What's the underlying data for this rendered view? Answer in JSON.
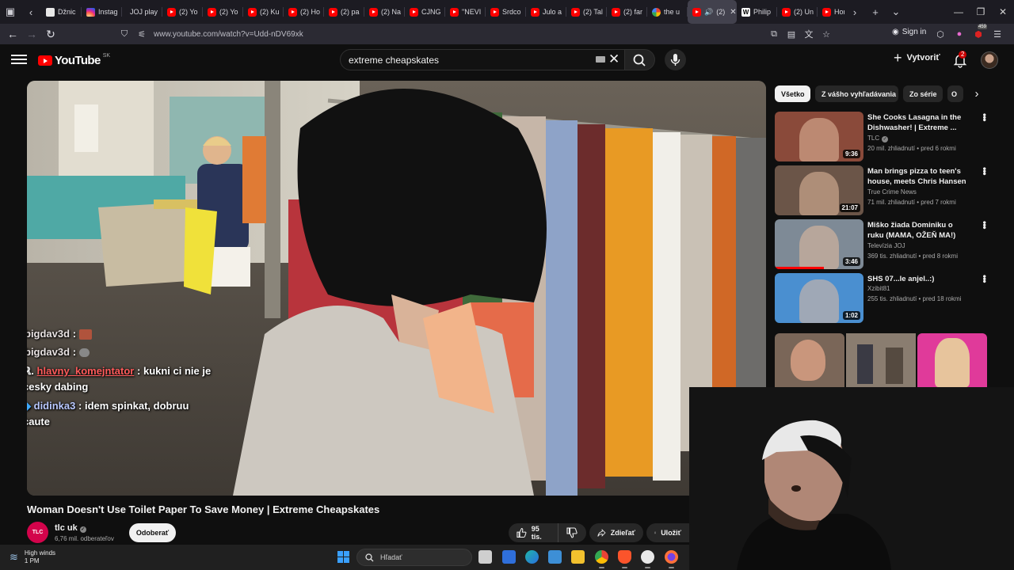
{
  "browser": {
    "tabs": [
      {
        "label": "Džnic",
        "icon": "doc"
      },
      {
        "label": "Instag",
        "icon": "instagram"
      },
      {
        "label": "JOJ play",
        "icon": "none"
      },
      {
        "label": "(2) Yo",
        "icon": "youtube"
      },
      {
        "label": "(2) Yo",
        "icon": "youtube"
      },
      {
        "label": "(2) Ku",
        "icon": "youtube"
      },
      {
        "label": "(2) Ho",
        "icon": "youtube"
      },
      {
        "label": "(2) pa",
        "icon": "youtube"
      },
      {
        "label": "(2) Na",
        "icon": "youtube"
      },
      {
        "label": "CJNG",
        "icon": "youtube"
      },
      {
        "label": "\"NEVI",
        "icon": "youtube"
      },
      {
        "label": "Srdco",
        "icon": "youtube"
      },
      {
        "label": "Julo a",
        "icon": "youtube"
      },
      {
        "label": "(2) Tal",
        "icon": "youtube"
      },
      {
        "label": "(2) far",
        "icon": "youtube"
      },
      {
        "label": "the u",
        "icon": "google"
      },
      {
        "label": "(2)",
        "icon": "youtube",
        "active": true
      },
      {
        "label": "Philip",
        "icon": "wikipedia"
      },
      {
        "label": "(2) Un",
        "icon": "youtube"
      },
      {
        "label": "Horvá",
        "icon": "youtube"
      }
    ],
    "url": "www.youtube.com/watch?v=Udd-nDV69xk",
    "sign_in": "Sign in",
    "extension_badge": "459"
  },
  "youtube": {
    "logo_text": "YouTube",
    "country_code": "SK",
    "search_query": "extreme cheapskates",
    "create_label": "Vytvoriť",
    "notification_count": "2"
  },
  "video": {
    "title": "Woman Doesn't Use Toilet Paper To Save Money | Extreme Cheapskates",
    "channel": "tlc uk",
    "channel_avatar_text": "TLC",
    "subscribers": "6,76 mil. odberateľov",
    "subscribe_label": "Odoberať",
    "likes": "95 tis.",
    "share_label": "Zdieľať",
    "save_label": "Uložiť"
  },
  "chat": [
    {
      "user": "bigdav3d",
      "sep": ":",
      "message": ""
    },
    {
      "user": "bigdav3d",
      "sep": ":",
      "message": ""
    },
    {
      "user": "hlavny_komejntator",
      "sep": ":",
      "message": "kukni ci nie je",
      "cont": "cesky dabing"
    },
    {
      "user": "didinka3",
      "sep": ":",
      "message": "idem spinkat, dobruu",
      "cont": "caute"
    }
  ],
  "chips": [
    "Všetko",
    "Z vášho vyhľadávania",
    "Zo série",
    "O"
  ],
  "recommendations": [
    {
      "title": "She Cooks Lasagna in the Dishwasher! | Extreme ...",
      "channel": "TLC",
      "verified": true,
      "meta": "20 mil. zhliadnutí • pred 6 rokmi",
      "duration": "9:36",
      "thumb_color": "#8a4a3a"
    },
    {
      "title": "Man brings pizza to teen's house, meets Chris Hansen ...",
      "channel": "True Crime News",
      "verified": false,
      "meta": "71 mil. zhliadnutí • pred 7 rokmi",
      "duration": "21:07",
      "thumb_color": "#6b5548"
    },
    {
      "title": "Miško žiada Dominiku o ruku (MAMA, OŽEŇ MA!)",
      "channel": "Televízia JOJ",
      "verified": false,
      "meta": "369 tis. zhliadnutí • pred 8 rokmi",
      "duration": "3:46",
      "thumb_color": "#7e8a96",
      "watched": 0.55
    },
    {
      "title": "SHS 07...le anjel..:)",
      "channel": "Xzibit81",
      "verified": false,
      "meta": "255 tis. zhliadnutí • pred 18 rokmi",
      "duration": "1:02",
      "thumb_color": "#4a8fd0"
    }
  ],
  "taskbar": {
    "weather_title": "High winds",
    "weather_sub": "1 PM",
    "search_placeholder": "Hľadať"
  },
  "colors": {
    "accent": "#ff0000",
    "background": "#0f0f0f",
    "chip": "#272727"
  }
}
